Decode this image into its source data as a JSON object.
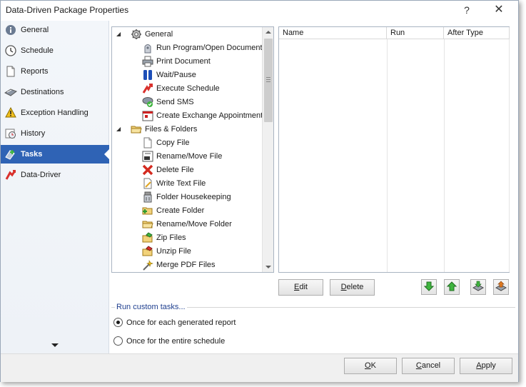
{
  "window": {
    "title": "Data-Driven Package Properties",
    "help_label": "?",
    "close_label": "✕"
  },
  "sidebar": {
    "items": [
      {
        "label": "General",
        "icon": "info-icon"
      },
      {
        "label": "Schedule",
        "icon": "clock-icon"
      },
      {
        "label": "Reports",
        "icon": "document-icon"
      },
      {
        "label": "Destinations",
        "icon": "destinations-icon"
      },
      {
        "label": "Exception Handling",
        "icon": "warning-icon"
      },
      {
        "label": "History",
        "icon": "history-icon"
      },
      {
        "label": "Tasks",
        "icon": "tasks-icon",
        "active": true
      },
      {
        "label": "Data-Driver",
        "icon": "data-driver-icon"
      }
    ]
  },
  "tree": {
    "groups": [
      {
        "label": "General",
        "expander": "◢",
        "items": [
          {
            "label": "Run Program/Open Document",
            "icon": "run-program-icon"
          },
          {
            "label": "Print Document",
            "icon": "printer-icon"
          },
          {
            "label": "Wait/Pause",
            "icon": "pause-icon"
          },
          {
            "label": "Execute Schedule",
            "icon": "execute-schedule-icon"
          },
          {
            "label": "Send SMS",
            "icon": "sms-icon"
          },
          {
            "label": "Create Exchange Appointment",
            "icon": "appointment-icon"
          }
        ]
      },
      {
        "label": "Files & Folders",
        "expander": "◢",
        "items": [
          {
            "label": "Copy File",
            "icon": "copy-file-icon"
          },
          {
            "label": "Rename/Move File",
            "icon": "rename-file-icon"
          },
          {
            "label": "Delete File",
            "icon": "delete-icon"
          },
          {
            "label": "Write Text File",
            "icon": "write-text-icon"
          },
          {
            "label": "Folder Housekeeping",
            "icon": "housekeeping-icon"
          },
          {
            "label": "Create Folder",
            "icon": "create-folder-icon"
          },
          {
            "label": "Rename/Move Folder",
            "icon": "rename-folder-icon"
          },
          {
            "label": "Zip Files",
            "icon": "zip-icon"
          },
          {
            "label": "Unzip File",
            "icon": "unzip-icon"
          },
          {
            "label": "Merge PDF Files",
            "icon": "merge-pdf-icon"
          }
        ]
      }
    ]
  },
  "task_list": {
    "columns": [
      "Name",
      "Run",
      "After Type"
    ]
  },
  "buttons": {
    "edit_prefix": "",
    "edit_key": "E",
    "edit_rest": "dit",
    "delete_key": "D",
    "delete_rest": "elete",
    "ok_key": "O",
    "ok_rest": "K",
    "cancel_key": "C",
    "cancel_rest": "ancel",
    "apply_key": "A",
    "apply_rest": "pply"
  },
  "run_options": {
    "group_label": "Run custom tasks...",
    "options": [
      {
        "label": "Once for each generated report",
        "selected": true
      },
      {
        "label": "Once for the entire schedule",
        "selected": false
      }
    ]
  },
  "colors": {
    "accent": "#2f63b5",
    "group_label": "#1f3f8f"
  }
}
